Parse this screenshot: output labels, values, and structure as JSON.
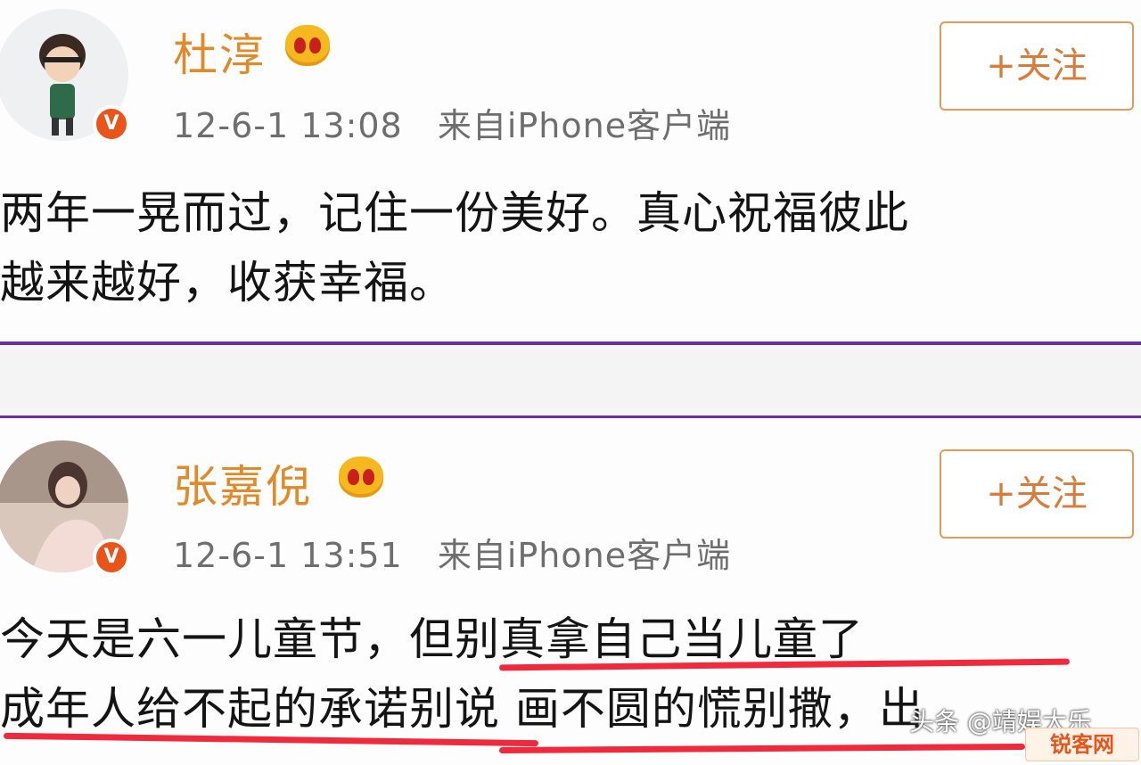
{
  "posts": [
    {
      "username": "杜淳",
      "time": "12-6-1 13:08",
      "source": "来自iPhone客户端",
      "follow_label": "+关注",
      "content_lines": [
        "两年一晃而过，记住一份美好。真心祝福彼此",
        "越来越好，收获幸福。"
      ]
    },
    {
      "username": "张嘉倪",
      "time": "12-6-1 13:51",
      "source": "来自iPhone客户端",
      "follow_label": "+关注",
      "content_lines": [
        "今天是六一儿童节，但别真拿自己当儿童了",
        "成年人给不起的承诺别说 画不圆的慌别撒，出"
      ]
    }
  ],
  "watermark": {
    "text": "头条 @靖娱大乐",
    "logo": "锐客网"
  },
  "colors": {
    "username": "#e08a2a",
    "verified_badge": "#e8541a",
    "vip_crown": "#f6b81f",
    "divider": "#6b2fa0",
    "highlight_underline": "#f02a3c",
    "follow_border": "#e39a5a"
  },
  "icons": [
    "avatar",
    "verified-v-icon",
    "vip-crown-icon"
  ]
}
